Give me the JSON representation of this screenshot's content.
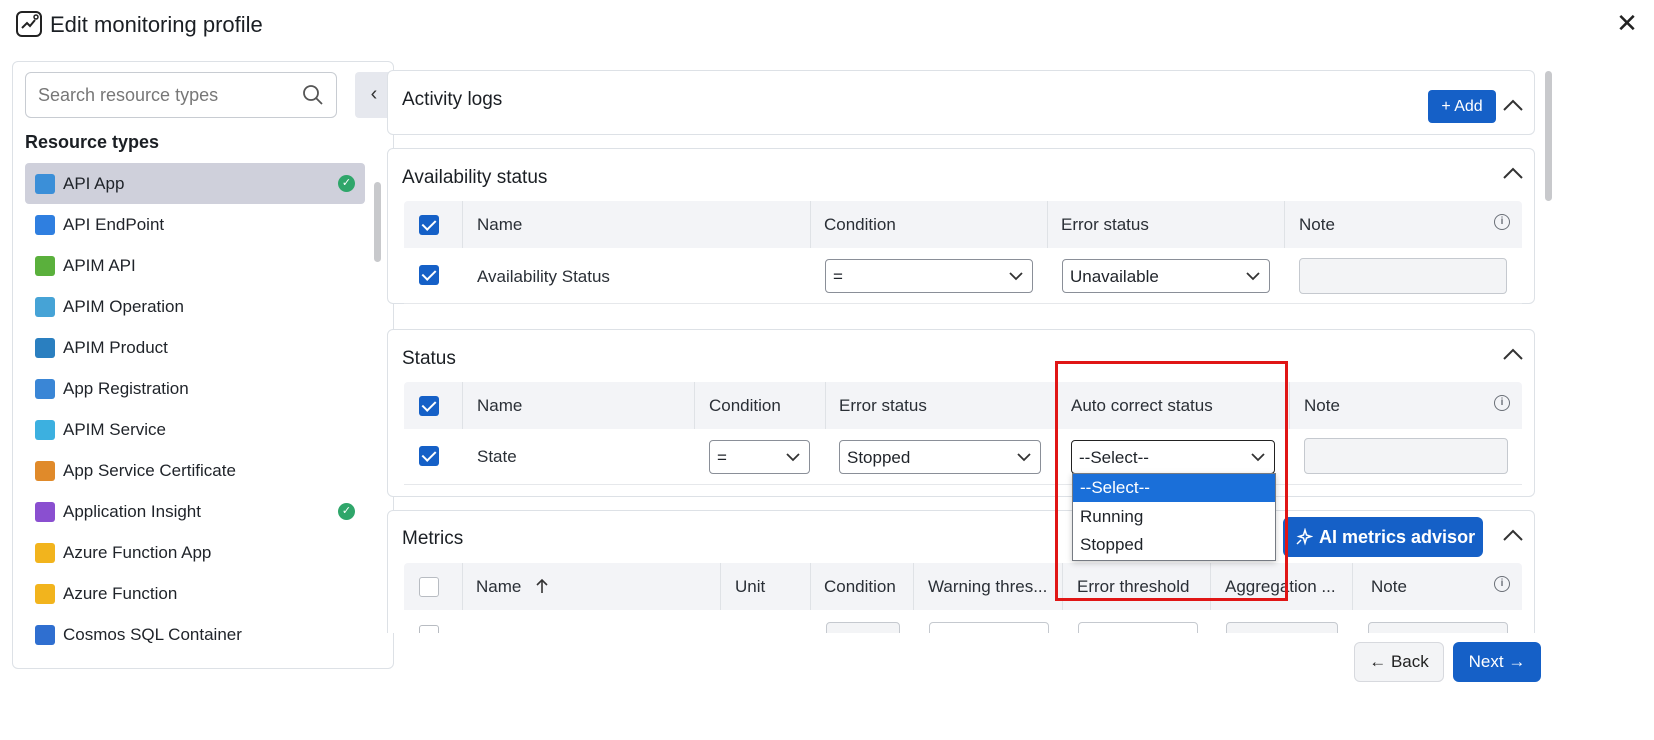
{
  "header": {
    "title": "Edit monitoring profile",
    "close_label": "✕"
  },
  "left": {
    "search_placeholder": "Search resource types",
    "collapse_label": "‹",
    "heading": "Resource types",
    "items": [
      {
        "label": "API App",
        "selected": true,
        "checked": true,
        "icon_color": "#3b8fd8"
      },
      {
        "label": "API EndPoint",
        "selected": false,
        "checked": false,
        "icon_color": "#2f7fe0"
      },
      {
        "label": "APIM API",
        "selected": false,
        "checked": false,
        "icon_color": "#5ab03c"
      },
      {
        "label": "APIM Operation",
        "selected": false,
        "checked": false,
        "icon_color": "#46a3d6"
      },
      {
        "label": "APIM Product",
        "selected": false,
        "checked": false,
        "icon_color": "#2a7fc0"
      },
      {
        "label": "App Registration",
        "selected": false,
        "checked": false,
        "icon_color": "#3a86d6"
      },
      {
        "label": "APIM Service",
        "selected": false,
        "checked": false,
        "icon_color": "#3cb0e0"
      },
      {
        "label": "App Service Certificate",
        "selected": false,
        "checked": false,
        "icon_color": "#e08a2a"
      },
      {
        "label": "Application Insight",
        "selected": false,
        "checked": true,
        "icon_color": "#8a4fd0"
      },
      {
        "label": "Azure Function App",
        "selected": false,
        "checked": false,
        "icon_color": "#f2b41d"
      },
      {
        "label": "Azure Function",
        "selected": false,
        "checked": false,
        "icon_color": "#f2b41d"
      },
      {
        "label": "Cosmos SQL Container",
        "selected": false,
        "checked": false,
        "icon_color": "#2f6fd0"
      }
    ]
  },
  "activity_logs": {
    "title": "Activity logs",
    "add_label": "+ Add"
  },
  "availability": {
    "title": "Availability status",
    "headers": {
      "name": "Name",
      "condition": "Condition",
      "error_status": "Error status",
      "note": "Note"
    },
    "row": {
      "name": "Availability Status",
      "condition": "=",
      "error_status": "Unavailable",
      "note": ""
    }
  },
  "status": {
    "title": "Status",
    "headers": {
      "name": "Name",
      "condition": "Condition",
      "error_status": "Error status",
      "auto_correct": "Auto correct status",
      "note": "Note"
    },
    "row": {
      "name": "State",
      "condition": "=",
      "error_status": "Stopped",
      "auto_correct": "--Select--",
      "note": ""
    },
    "dropdown_options": [
      "--Select--",
      "Running",
      "Stopped"
    ]
  },
  "metrics": {
    "title": "Metrics",
    "ai_label": "AI metrics advisor",
    "headers": {
      "name": "Name",
      "unit": "Unit",
      "condition": "Condition",
      "warning": "Warning thres...",
      "error": "Error threshold",
      "aggregation": "Aggregation ...",
      "note": "Note"
    }
  },
  "footer": {
    "back_label": "Back",
    "next_label": "Next"
  }
}
